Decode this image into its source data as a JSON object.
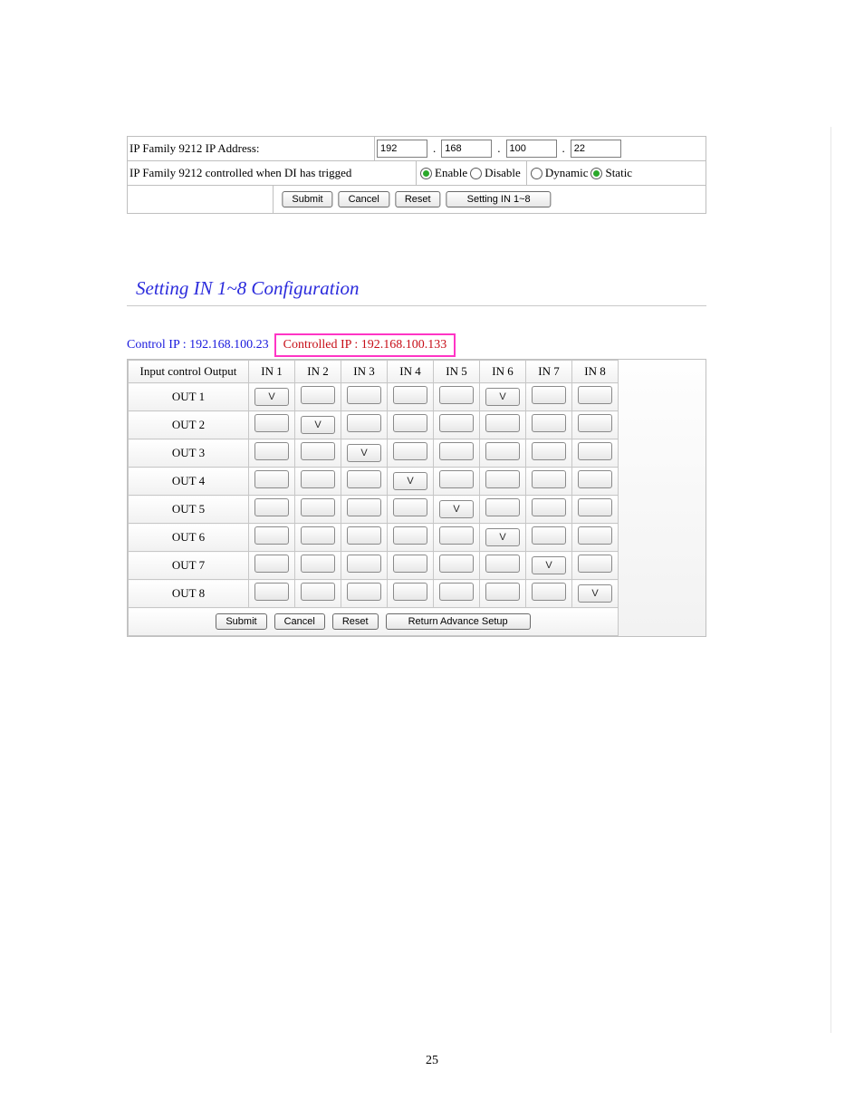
{
  "upper": {
    "ip_label": "IP Family 9212 IP Address:",
    "ip": {
      "a": "192",
      "b": "168",
      "c": "100",
      "d": "22"
    },
    "di_label": "IP Family 9212 controlled when DI has trigged",
    "enable_label": "Enable",
    "disable_label": "Disable",
    "dynamic_label": "Dynamic",
    "static_label": "Static",
    "enable_selected": true,
    "static_selected": true,
    "buttons": {
      "submit": "Submit",
      "cancel": "Cancel",
      "reset": "Reset",
      "setting": "Setting IN 1~8"
    }
  },
  "section_title": "Setting IN 1~8 Configuration",
  "ips": {
    "control_label": "Control IP : 192.168.100.23",
    "controlled_label": "Controlled IP : 192.168.100.133"
  },
  "matrix": {
    "first_header": "Input control Output",
    "col_headers": [
      "IN 1",
      "IN 2",
      "IN 3",
      "IN 4",
      "IN 5",
      "IN 6",
      "IN 7",
      "IN 8"
    ],
    "rows": [
      {
        "label": "OUT 1",
        "marks": [
          "V",
          "",
          "",
          "",
          "",
          "V",
          "",
          ""
        ]
      },
      {
        "label": "OUT 2",
        "marks": [
          "",
          "V",
          "",
          "",
          "",
          "",
          "",
          ""
        ]
      },
      {
        "label": "OUT 3",
        "marks": [
          "",
          "",
          "V",
          "",
          "",
          "",
          "",
          ""
        ]
      },
      {
        "label": "OUT 4",
        "marks": [
          "",
          "",
          "",
          "V",
          "",
          "",
          "",
          ""
        ]
      },
      {
        "label": "OUT 5",
        "marks": [
          "",
          "",
          "",
          "",
          "V",
          "",
          "",
          ""
        ]
      },
      {
        "label": "OUT 6",
        "marks": [
          "",
          "",
          "",
          "",
          "",
          "V",
          "",
          ""
        ]
      },
      {
        "label": "OUT 7",
        "marks": [
          "",
          "",
          "",
          "",
          "",
          "",
          "V",
          ""
        ]
      },
      {
        "label": "OUT 8",
        "marks": [
          "",
          "",
          "",
          "",
          "",
          "",
          "",
          "V"
        ]
      }
    ],
    "buttons": {
      "submit": "Submit",
      "cancel": "Cancel",
      "reset": "Reset",
      "return": "Return Advance Setup"
    }
  },
  "page_number": "25"
}
